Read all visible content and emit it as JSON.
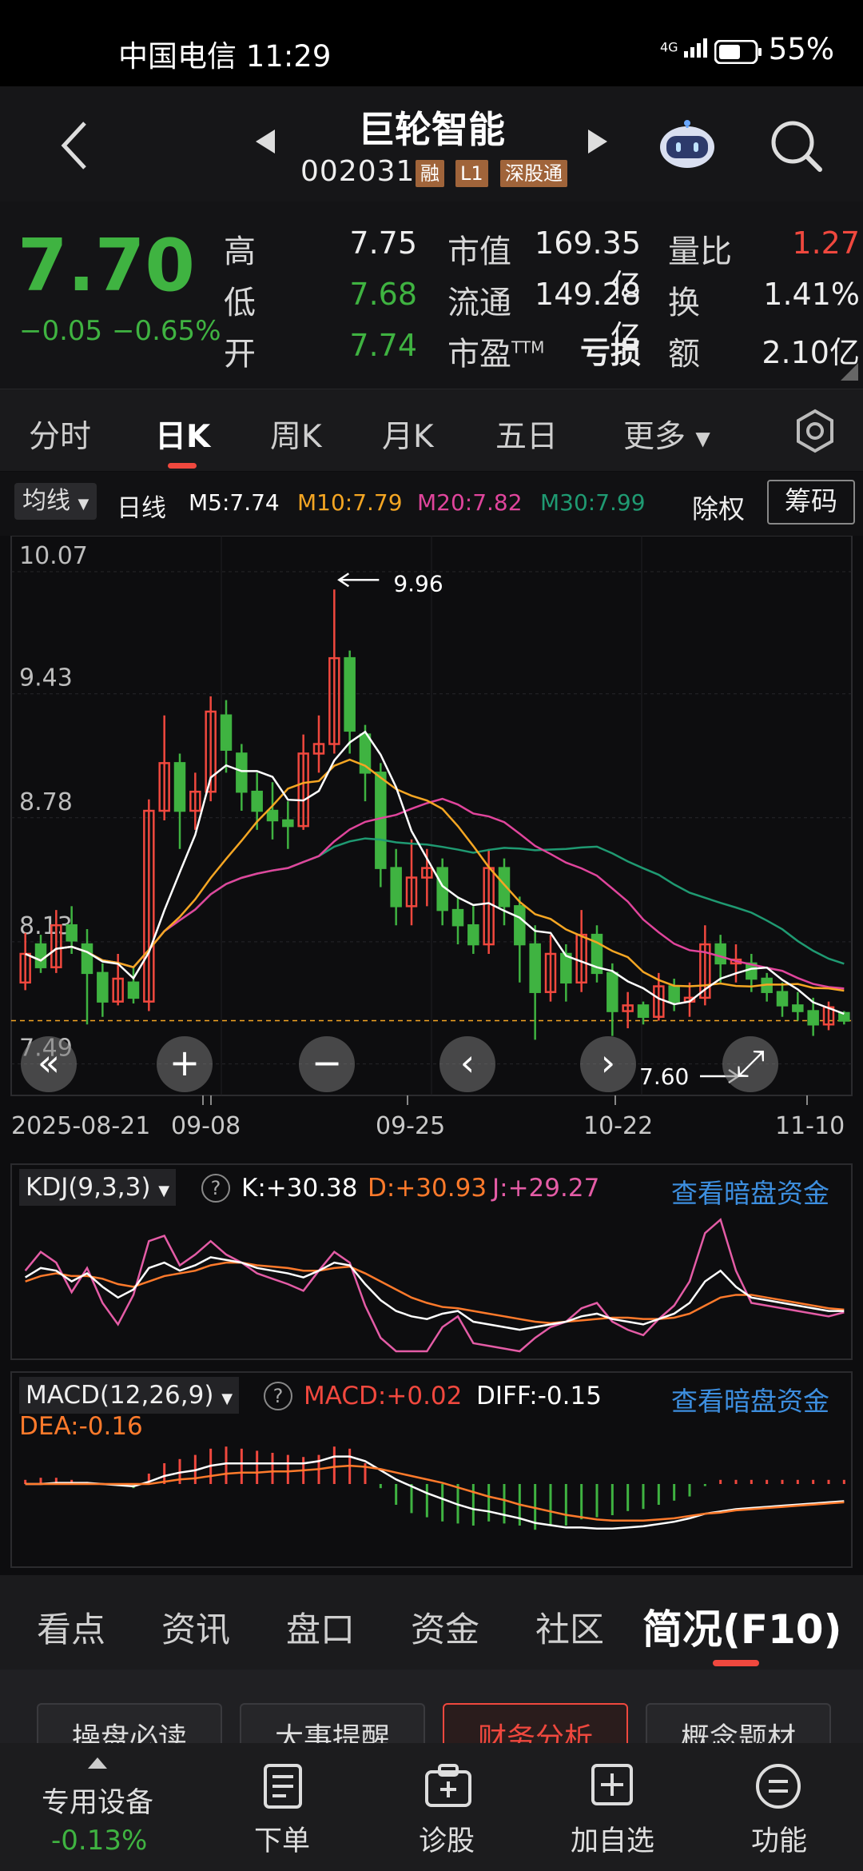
{
  "status": {
    "carrier": "中国电信 11:29",
    "battery": "55%",
    "signal": "4G"
  },
  "header": {
    "name": "巨轮智能",
    "code": "002031",
    "tags": [
      "融",
      "L1",
      "深股通"
    ]
  },
  "quote": {
    "price": "7.70",
    "change": "−0.05",
    "change_pct": "−0.65%",
    "high_label": "高",
    "high": "7.75",
    "low_label": "低",
    "low": "7.68",
    "open_label": "开",
    "open": "7.74",
    "mktcap_label": "市值",
    "mktcap": "169.35亿",
    "float_label": "流通",
    "float": "149.28亿",
    "pe_label": "市盈",
    "pe_sup": "TTM",
    "pe": "亏损",
    "vol_ratio_label": "量比",
    "vol_ratio": "1.27",
    "turnover_label": "换",
    "turnover": "1.41%",
    "amount_label": "额",
    "amount": "2.10亿"
  },
  "tabs": [
    "分时",
    "日K",
    "周K",
    "月K",
    "五日",
    "更多"
  ],
  "ma_row": {
    "dropdown": "均线",
    "period": "日线",
    "m5": "M5:7.74",
    "m10": "M10:7.79",
    "m20": "M20:7.82",
    "m30": "M30:7.99",
    "exright": "除权",
    "chips": "筹码",
    "colors": {
      "m5": "#ffffff",
      "m10": "#f5a623",
      "m20": "#e0459c",
      "m30": "#1f9a72"
    }
  },
  "chart_data": [
    {
      "type": "candlestick",
      "title": "日线",
      "y_ticks": [
        "10.07",
        "9.43",
        "8.78",
        "8.13",
        "7.49"
      ],
      "ylim": [
        7.49,
        10.07
      ],
      "x_ticks": [
        "2025-08-21",
        "09-08",
        "09-25",
        "10-22",
        "11-10"
      ],
      "annotations": {
        "max": "9.96",
        "min": "7.60"
      },
      "current_price_line": 7.7,
      "candles": [
        [
          7.9,
          8.05,
          8.16,
          7.86
        ],
        [
          8.1,
          7.98,
          8.15,
          7.95
        ],
        [
          7.98,
          8.2,
          8.28,
          7.95
        ],
        [
          8.2,
          8.12,
          8.3,
          8.05
        ],
        [
          8.1,
          7.95,
          8.18,
          7.68
        ],
        [
          7.95,
          7.8,
          8.0,
          7.72
        ],
        [
          7.8,
          7.92,
          8.05,
          7.78
        ],
        [
          7.9,
          7.82,
          7.98,
          7.79
        ],
        [
          7.8,
          8.8,
          8.86,
          7.75
        ],
        [
          8.8,
          9.05,
          9.3,
          8.75
        ],
        [
          9.05,
          8.8,
          9.1,
          8.6
        ],
        [
          8.8,
          8.9,
          9.0,
          8.7
        ],
        [
          8.9,
          9.32,
          9.4,
          8.85
        ],
        [
          9.3,
          9.12,
          9.38,
          9.0
        ],
        [
          9.1,
          8.9,
          9.15,
          8.8
        ],
        [
          8.9,
          8.8,
          9.0,
          8.7
        ],
        [
          8.8,
          8.75,
          8.95,
          8.65
        ],
        [
          8.75,
          8.72,
          8.85,
          8.6
        ],
        [
          8.72,
          9.1,
          9.2,
          8.7
        ],
        [
          9.1,
          9.15,
          9.3,
          9.0
        ],
        [
          9.15,
          9.6,
          9.96,
          9.1
        ],
        [
          9.6,
          9.22,
          9.64,
          9.1
        ],
        [
          9.2,
          9.0,
          9.25,
          8.85
        ],
        [
          9.0,
          8.5,
          9.05,
          8.4
        ],
        [
          8.5,
          8.3,
          8.6,
          8.2
        ],
        [
          8.3,
          8.45,
          8.65,
          8.2
        ],
        [
          8.45,
          8.5,
          8.6,
          8.3
        ],
        [
          8.5,
          8.28,
          8.55,
          8.2
        ],
        [
          8.28,
          8.2,
          8.35,
          8.1
        ],
        [
          8.2,
          8.1,
          8.3,
          8.05
        ],
        [
          8.1,
          8.5,
          8.6,
          8.05
        ],
        [
          8.5,
          8.3,
          8.55,
          8.2
        ],
        [
          8.3,
          8.1,
          8.35,
          7.9
        ],
        [
          8.1,
          7.85,
          8.2,
          7.6
        ],
        [
          7.85,
          8.05,
          8.15,
          7.8
        ],
        [
          8.05,
          7.9,
          8.1,
          7.8
        ],
        [
          7.9,
          8.15,
          8.28,
          7.85
        ],
        [
          8.15,
          7.95,
          8.2,
          7.9
        ],
        [
          7.95,
          7.75,
          8.0,
          7.62
        ],
        [
          7.75,
          7.78,
          7.85,
          7.66
        ],
        [
          7.78,
          7.72,
          7.8,
          7.68
        ],
        [
          7.72,
          7.88,
          7.95,
          7.7
        ],
        [
          7.88,
          7.8,
          7.92,
          7.75
        ],
        [
          7.8,
          7.82,
          7.9,
          7.72
        ],
        [
          7.82,
          8.1,
          8.2,
          7.78
        ],
        [
          8.1,
          8.0,
          8.15,
          7.9
        ],
        [
          8.0,
          8.02,
          8.1,
          7.9
        ],
        [
          8.0,
          7.92,
          8.05,
          7.85
        ],
        [
          7.92,
          7.85,
          7.95,
          7.8
        ],
        [
          7.85,
          7.78,
          7.9,
          7.72
        ],
        [
          7.78,
          7.75,
          7.85,
          7.7
        ],
        [
          7.75,
          7.68,
          7.82,
          7.62
        ],
        [
          7.68,
          7.77,
          7.8,
          7.65
        ],
        [
          7.74,
          7.7,
          7.75,
          7.68
        ]
      ]
    },
    {
      "type": "line",
      "title": "KDJ(9,3,3)",
      "series": [
        {
          "name": "K:+30.38",
          "color": "#ffffff",
          "values": [
            55,
            62,
            60,
            52,
            58,
            48,
            40,
            46,
            62,
            66,
            60,
            64,
            70,
            68,
            66,
            62,
            60,
            58,
            55,
            60,
            66,
            64,
            50,
            38,
            30,
            26,
            24,
            28,
            30,
            22,
            20,
            18,
            16,
            18,
            20,
            22,
            26,
            28,
            24,
            22,
            20,
            24,
            28,
            36,
            52,
            60,
            48,
            40,
            38,
            36,
            34,
            32,
            30,
            30
          ]
        },
        {
          "name": "D:+30.93",
          "color": "#ff7a2b",
          "values": [
            52,
            56,
            58,
            56,
            56,
            54,
            50,
            48,
            52,
            56,
            58,
            60,
            64,
            66,
            66,
            64,
            63,
            62,
            60,
            60,
            62,
            63,
            58,
            52,
            46,
            40,
            36,
            33,
            32,
            30,
            28,
            26,
            24,
            22,
            21,
            22,
            23,
            24,
            25,
            25,
            24,
            24,
            25,
            28,
            34,
            40,
            42,
            42,
            40,
            38,
            36,
            34,
            32,
            31
          ]
        },
        {
          "name": "J:+29.27",
          "color": "#e45ca6",
          "values": [
            60,
            74,
            66,
            44,
            62,
            36,
            20,
            42,
            82,
            86,
            64,
            72,
            82,
            72,
            66,
            58,
            54,
            50,
            45,
            60,
            74,
            66,
            34,
            10,
            0,
            0,
            0,
            18,
            26,
            6,
            4,
            2,
            0,
            10,
            18,
            22,
            32,
            36,
            22,
            16,
            12,
            24,
            34,
            52,
            88,
            98,
            60,
            36,
            34,
            32,
            30,
            28,
            26,
            29
          ]
        }
      ]
    },
    {
      "type": "bar",
      "title": "MACD(12,26,9)",
      "series": [
        {
          "name": "MACD:+0.02",
          "values": [
            0.02,
            0.03,
            0.03,
            0.02,
            0.01,
            0.0,
            -0.01,
            -0.02,
            0.05,
            0.1,
            0.12,
            0.14,
            0.17,
            0.18,
            0.17,
            0.16,
            0.15,
            0.14,
            0.13,
            0.14,
            0.18,
            0.17,
            0.1,
            -0.02,
            -0.1,
            -0.14,
            -0.16,
            -0.18,
            -0.19,
            -0.2,
            -0.18,
            -0.19,
            -0.2,
            -0.22,
            -0.2,
            -0.2,
            -0.17,
            -0.16,
            -0.15,
            -0.13,
            -0.12,
            -0.1,
            -0.08,
            -0.06,
            -0.01,
            0.02,
            0.02,
            0.02,
            0.02,
            0.02,
            0.02,
            0.02,
            0.02,
            0.02
          ]
        },
        {
          "name": "DIFF:-0.15",
          "values": [
            0.0,
            0.0,
            0.01,
            0.01,
            0.01,
            0.0,
            -0.01,
            -0.02,
            0.02,
            0.07,
            0.1,
            0.12,
            0.16,
            0.18,
            0.18,
            0.18,
            0.18,
            0.18,
            0.18,
            0.2,
            0.24,
            0.24,
            0.2,
            0.12,
            0.04,
            -0.02,
            -0.08,
            -0.13,
            -0.18,
            -0.22,
            -0.24,
            -0.27,
            -0.3,
            -0.34,
            -0.36,
            -0.38,
            -0.38,
            -0.39,
            -0.39,
            -0.38,
            -0.37,
            -0.35,
            -0.33,
            -0.3,
            -0.26,
            -0.24,
            -0.22,
            -0.21,
            -0.2,
            -0.19,
            -0.18,
            -0.17,
            -0.16,
            -0.15
          ]
        },
        {
          "name": "DEA:-0.16",
          "values": [
            0.0,
            0.0,
            0.0,
            0.0,
            0.0,
            0.0,
            0.0,
            0.0,
            0.0,
            0.02,
            0.04,
            0.05,
            0.07,
            0.09,
            0.1,
            0.1,
            0.11,
            0.11,
            0.12,
            0.13,
            0.15,
            0.16,
            0.15,
            0.13,
            0.1,
            0.07,
            0.04,
            0.01,
            -0.03,
            -0.07,
            -0.11,
            -0.14,
            -0.18,
            -0.21,
            -0.24,
            -0.27,
            -0.29,
            -0.31,
            -0.32,
            -0.32,
            -0.32,
            -0.31,
            -0.3,
            -0.28,
            -0.26,
            -0.25,
            -0.23,
            -0.22,
            -0.21,
            -0.2,
            -0.19,
            -0.18,
            -0.17,
            -0.16
          ]
        }
      ]
    }
  ],
  "kdj_link": "查看暗盘资金",
  "macd_link": "查看暗盘资金",
  "chart_controls": [
    "«",
    "+",
    "−",
    "‹",
    "›",
    "⤢"
  ],
  "bottom_tabs": [
    "看点",
    "资讯",
    "盘口",
    "资金",
    "社区",
    "简况(F10)"
  ],
  "f10_buttons": [
    "操盘必读",
    "大事提醒",
    "财务分析",
    "概念题材"
  ],
  "nav": {
    "left_title": "专用设备",
    "left_change": "-0.13%",
    "items": [
      "下单",
      "诊股",
      "加自选",
      "功能"
    ]
  }
}
